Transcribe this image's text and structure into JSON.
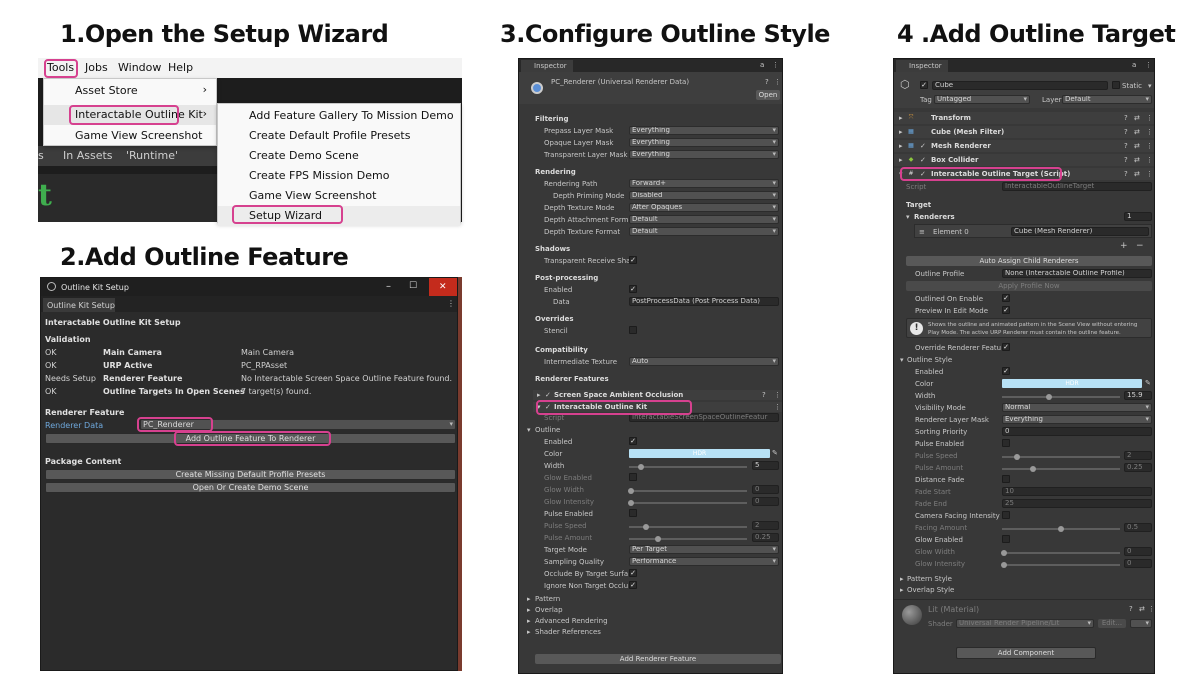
{
  "headings": {
    "step1": "1.Open the Setup Wizard",
    "step2": "2.Add Outline Feature",
    "step3": "3.Configure Outline Style",
    "step4": "4 .Add Outline Target"
  },
  "colors": {
    "highlight": "#d6418f",
    "hdr_color": "#b7e1f5",
    "close_button": "#c42b1c",
    "unity_dark": "#383838"
  },
  "panel1": {
    "menubar": [
      "Tools",
      "Jobs",
      "Window",
      "Help"
    ],
    "tools_menu": [
      {
        "label": "Asset Store",
        "arrow": "›"
      },
      {
        "label": "Interactable Outline Kit",
        "arrow": "›"
      },
      {
        "label": "Game View Screenshot",
        "arrow": ""
      }
    ],
    "submenu": [
      "Add Feature Gallery To Mission Demo",
      "Create Default Profile Presets",
      "Create Demo Scene",
      "Create FPS Mission Demo",
      "Game View Screenshot",
      "Setup Wizard"
    ],
    "background_bar": {
      "left": "s",
      "middle": "In Assets",
      "right": "'Runtime'"
    }
  },
  "panel2": {
    "window_title": "Outline Kit Setup",
    "window_buttons": {
      "minimize": "–",
      "maximize": "☐",
      "close": "✕"
    },
    "tab_label": "Outline Kit Setup",
    "menu_glyph": "⋮",
    "section_title": "Interactable Outline Kit Setup",
    "validation_title": "Validation",
    "validation_rows": [
      {
        "status": "OK",
        "item": "Main Camera",
        "detail": "Main Camera"
      },
      {
        "status": "OK",
        "item": "URP Active",
        "detail": "PC_RPAsset"
      },
      {
        "status": "Needs Setup",
        "item": "Renderer Feature",
        "detail": "No Interactable Screen Space Outline Feature found."
      },
      {
        "status": "OK",
        "item": "Outline Targets In Open Scenes",
        "detail": "7 target(s) found."
      }
    ],
    "renderer_feature_title": "Renderer Feature",
    "renderer_data_label": "Renderer Data",
    "renderer_data_value": "PC_Renderer",
    "add_feature_button": "Add Outline Feature To Renderer",
    "package_content_title": "Package Content",
    "create_presets_button": "Create Missing Default Profile Presets",
    "open_demo_button": "Open Or Create Demo Scene"
  },
  "panel3": {
    "tab": "Inspector",
    "header_glyphs": {
      "lock": "a",
      "menu": "⋮",
      "help": "?",
      "settings": "⇄"
    },
    "asset_title": "PC_Renderer (Universal Renderer Data)",
    "open_button": "Open",
    "filtering": {
      "title": "Filtering",
      "rows": [
        {
          "label": "Prepass Layer Mask",
          "value": "Everything"
        },
        {
          "label": "Opaque Layer Mask",
          "value": "Everything"
        },
        {
          "label": "Transparent Layer Mask",
          "value": "Everything"
        }
      ]
    },
    "rendering": {
      "title": "Rendering",
      "rows": [
        {
          "label": "Rendering Path",
          "value": "Forward+"
        },
        {
          "label": "Depth Priming Mode",
          "value": "Disabled"
        },
        {
          "label": "Depth Texture Mode",
          "value": "After Opaques"
        },
        {
          "label": "Depth Attachment Forma",
          "value": "Default"
        },
        {
          "label": "Depth Texture Format",
          "value": "Default"
        }
      ]
    },
    "shadows": {
      "title": "Shadows",
      "label": "Transparent Receive Sha",
      "checked": "✓"
    },
    "postprocessing": {
      "title": "Post-processing",
      "enabled_label": "Enabled",
      "enabled_check": "✓",
      "data_label": "Data",
      "data_value": "PostProcessData (Post Process Data)"
    },
    "overrides": {
      "title": "Overrides",
      "stencil_label": "Stencil"
    },
    "compatibility": {
      "title": "Compatibility",
      "label": "Intermediate Texture",
      "value": "Auto"
    },
    "renderer_features": {
      "title": "Renderer Features",
      "ssao_label": "Screen Space Ambient Occlusion",
      "outline_kit_label": "Interactable Outline Kit",
      "script_label": "Script",
      "script_value": "InteractableScreenSpaceOutlineFeatur"
    },
    "outline": {
      "title": "Outline",
      "enabled_label": "Enabled",
      "color_label": "Color",
      "color_value": "HDR",
      "width_label": "Width",
      "width_value": "5",
      "width_fraction": 0.1,
      "glow_enabled_label": "Glow Enabled",
      "glow_width_label": "Glow Width",
      "glow_width_value": "0",
      "glow_intensity_label": "Glow Intensity",
      "glow_intensity_value": "0",
      "pulse_enabled_label": "Pulse Enabled",
      "pulse_speed_label": "Pulse Speed",
      "pulse_speed_value": "2",
      "pulse_amount_label": "Pulse Amount",
      "pulse_amount_value": "0.25",
      "target_mode_label": "Target Mode",
      "target_mode_value": "Per Target",
      "sampling_label": "Sampling Quality",
      "sampling_value": "Performance",
      "occlude_label": "Occlude By Target Surfa",
      "ignore_label": "Ignore Non Target Occlu"
    },
    "foldouts": [
      "Pattern",
      "Overlap",
      "Advanced Rendering",
      "Shader References"
    ],
    "add_feature_button": "Add Renderer Feature"
  },
  "panel4": {
    "tab": "Inspector",
    "object_name": "Cube",
    "static_label": "Static",
    "tag_label": "Tag",
    "tag_value": "Untagged",
    "layer_label": "Layer",
    "layer_value": "Default",
    "components": [
      {
        "name": "Transform",
        "icon": "⤧",
        "icon_color": "#e8a33d",
        "check": ""
      },
      {
        "name": "Cube (Mesh Filter)",
        "icon": "▦",
        "icon_color": "#6aa8e0",
        "check": ""
      },
      {
        "name": "Mesh Renderer",
        "icon": "▦",
        "icon_color": "#6aa8e0",
        "check": "✓"
      },
      {
        "name": "Box Collider",
        "icon": "◆",
        "icon_color": "#8cc63e",
        "check": "✓"
      },
      {
        "name": "Interactable Outline Target (Script)",
        "icon": "#",
        "icon_color": "#dcdcdc",
        "check": "✓"
      }
    ],
    "script_label": "Script",
    "script_value": "InteractableOutlineTarget",
    "target_title": "Target",
    "renderers_label": "Renderers",
    "renderers_count": "1",
    "element_label": "Element 0",
    "element_value": "Cube (Mesh Renderer)",
    "list_buttons": {
      "add": "+",
      "remove": "−"
    },
    "auto_assign_button": "Auto Assign Child Renderers",
    "outline_profile_label": "Outline Profile",
    "outline_profile_value": "None (Interactable Outline Profile)",
    "apply_profile_button": "Apply Profile Now",
    "outlined_on_enable_label": "Outlined On Enable",
    "preview_label": "Preview In Edit Mode",
    "info_text_1": "Shows the outline and animated pattern in the Scene View without entering",
    "info_text_2": "Play Mode. The active URP Renderer must contain the outline feature.",
    "override_renderer_label": "Override Renderer Featu",
    "outline_style_title": "Outline Style",
    "style": {
      "enabled_label": "Enabled",
      "color_label": "Color",
      "color_value": "HDR",
      "width_label": "Width",
      "width_value": "15.9",
      "width_fraction": 0.4,
      "visibility_label": "Visibility Mode",
      "visibility_value": "Normal",
      "layer_mask_label": "Renderer Layer Mask",
      "layer_mask_value": "Everything",
      "sorting_label": "Sorting Priority",
      "sorting_value": "0",
      "pulse_enabled_label": "Pulse Enabled",
      "pulse_speed_label": "Pulse Speed",
      "pulse_speed_value": "2",
      "pulse_amount_label": "Pulse Amount",
      "pulse_amount_value": "0.25",
      "distance_fade_label": "Distance Fade",
      "fade_start_label": "Fade Start",
      "fade_start_value": "10",
      "fade_end_label": "Fade End",
      "fade_end_value": "25",
      "camera_facing_label": "Camera Facing Intensity",
      "facing_amount_label": "Facing Amount",
      "facing_amount_value": "0.5",
      "glow_enabled_label": "Glow Enabled",
      "glow_width_label": "Glow Width",
      "glow_width_value": "0",
      "glow_intensity_label": "Glow Intensity",
      "glow_intensity_value": "0"
    },
    "pattern_style_label": "Pattern Style",
    "overlap_style_label": "Overlap Style",
    "material_name": "Lit (Material)",
    "shader_label": "Shader",
    "shader_value": "Universal Render Pipeline/Lit",
    "edit_button": "Edit...",
    "add_component_button": "Add Component"
  }
}
